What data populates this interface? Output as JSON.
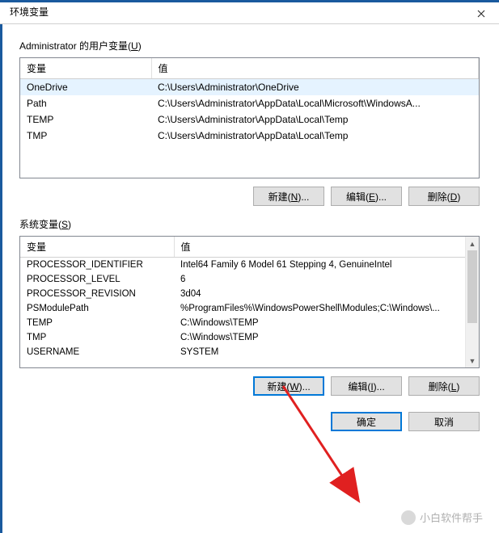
{
  "window": {
    "title": "环境变量"
  },
  "user": {
    "label_pre": "Administrator 的用户变量(",
    "label_key": "U",
    "label_post": ")",
    "col_var": "变量",
    "col_val": "值",
    "rows": [
      {
        "name": "OneDrive",
        "value": "C:\\Users\\Administrator\\OneDrive",
        "selected": true
      },
      {
        "name": "Path",
        "value": "C:\\Users\\Administrator\\AppData\\Local\\Microsoft\\WindowsA..."
      },
      {
        "name": "TEMP",
        "value": "C:\\Users\\Administrator\\AppData\\Local\\Temp"
      },
      {
        "name": "TMP",
        "value": "C:\\Users\\Administrator\\AppData\\Local\\Temp"
      }
    ],
    "btn_new_pre": "新建(",
    "btn_new_key": "N",
    "btn_new_post": ")...",
    "btn_edit_pre": "编辑(",
    "btn_edit_key": "E",
    "btn_edit_post": ")...",
    "btn_del_pre": "删除(",
    "btn_del_key": "D",
    "btn_del_post": ")"
  },
  "sys": {
    "label_pre": "系统变量(",
    "label_key": "S",
    "label_post": ")",
    "col_var": "变量",
    "col_val": "值",
    "rows": [
      {
        "name": "PROCESSOR_IDENTIFIER",
        "value": "Intel64 Family 6 Model 61 Stepping 4, GenuineIntel"
      },
      {
        "name": "PROCESSOR_LEVEL",
        "value": "6"
      },
      {
        "name": "PROCESSOR_REVISION",
        "value": "3d04"
      },
      {
        "name": "PSModulePath",
        "value": "%ProgramFiles%\\WindowsPowerShell\\Modules;C:\\Windows\\..."
      },
      {
        "name": "TEMP",
        "value": "C:\\Windows\\TEMP"
      },
      {
        "name": "TMP",
        "value": "C:\\Windows\\TEMP"
      },
      {
        "name": "USERNAME",
        "value": "SYSTEM"
      }
    ],
    "btn_new_pre": "新建(",
    "btn_new_key": "W",
    "btn_new_post": ")...",
    "btn_edit_pre": "编辑(",
    "btn_edit_key": "I",
    "btn_edit_post": ")...",
    "btn_del_pre": "删除(",
    "btn_del_key": "L",
    "btn_del_post": ")"
  },
  "dialog": {
    "ok": "确定",
    "cancel": "取消"
  },
  "watermark": "小白软件帮手"
}
